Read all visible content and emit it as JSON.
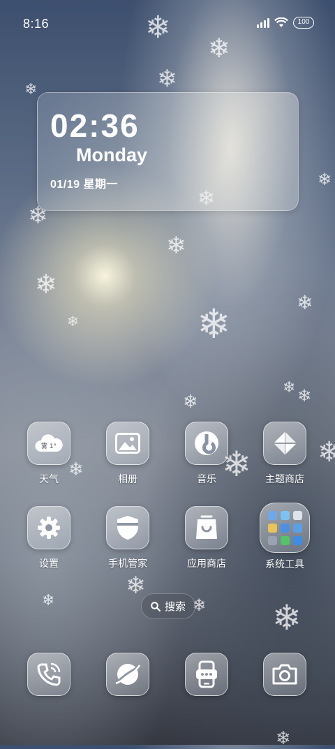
{
  "status_bar": {
    "time": "8:16",
    "battery": "100"
  },
  "clock_widget": {
    "time": "02:36",
    "day": "Monday",
    "date": "01/19 星期一"
  },
  "weather_icon_text": "雾 1°",
  "apps_row1": [
    {
      "name": "weather",
      "label": "天气"
    },
    {
      "name": "gallery",
      "label": "相册"
    },
    {
      "name": "music",
      "label": "音乐"
    },
    {
      "name": "theme-store",
      "label": "主题商店"
    }
  ],
  "apps_row2": [
    {
      "name": "settings",
      "label": "设置"
    },
    {
      "name": "phone-manager",
      "label": "手机管家"
    },
    {
      "name": "app-store",
      "label": "应用商店"
    },
    {
      "name": "system-tools",
      "label": "系统工具"
    }
  ],
  "search": {
    "label": "搜索"
  },
  "dock": [
    "phone-icon",
    "browser-icon",
    "messages-icon",
    "camera-icon"
  ],
  "colors": {
    "icon_fg": "#ffffff",
    "glass": "rgba(255,255,255,0.35)"
  }
}
